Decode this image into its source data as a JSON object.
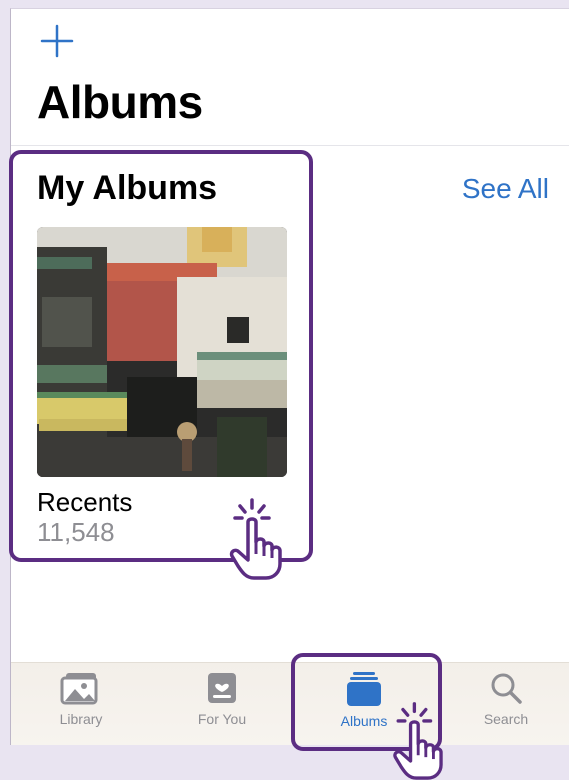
{
  "header": {
    "title": "Albums",
    "add_icon": "plus-icon"
  },
  "section": {
    "title": "My Albums",
    "see_all_label": "See All"
  },
  "album": {
    "name": "Recents",
    "count": "11,548"
  },
  "tabs": [
    {
      "label": "Library",
      "icon": "photo-library-icon",
      "active": false
    },
    {
      "label": "For You",
      "icon": "for-you-icon",
      "active": false
    },
    {
      "label": "Albums",
      "icon": "albums-stack-icon",
      "active": true
    },
    {
      "label": "Search",
      "icon": "search-icon",
      "active": false
    }
  ],
  "colors": {
    "accent": "#2f73c7",
    "highlight": "#5b2d82",
    "background": "#e9e4f1"
  }
}
